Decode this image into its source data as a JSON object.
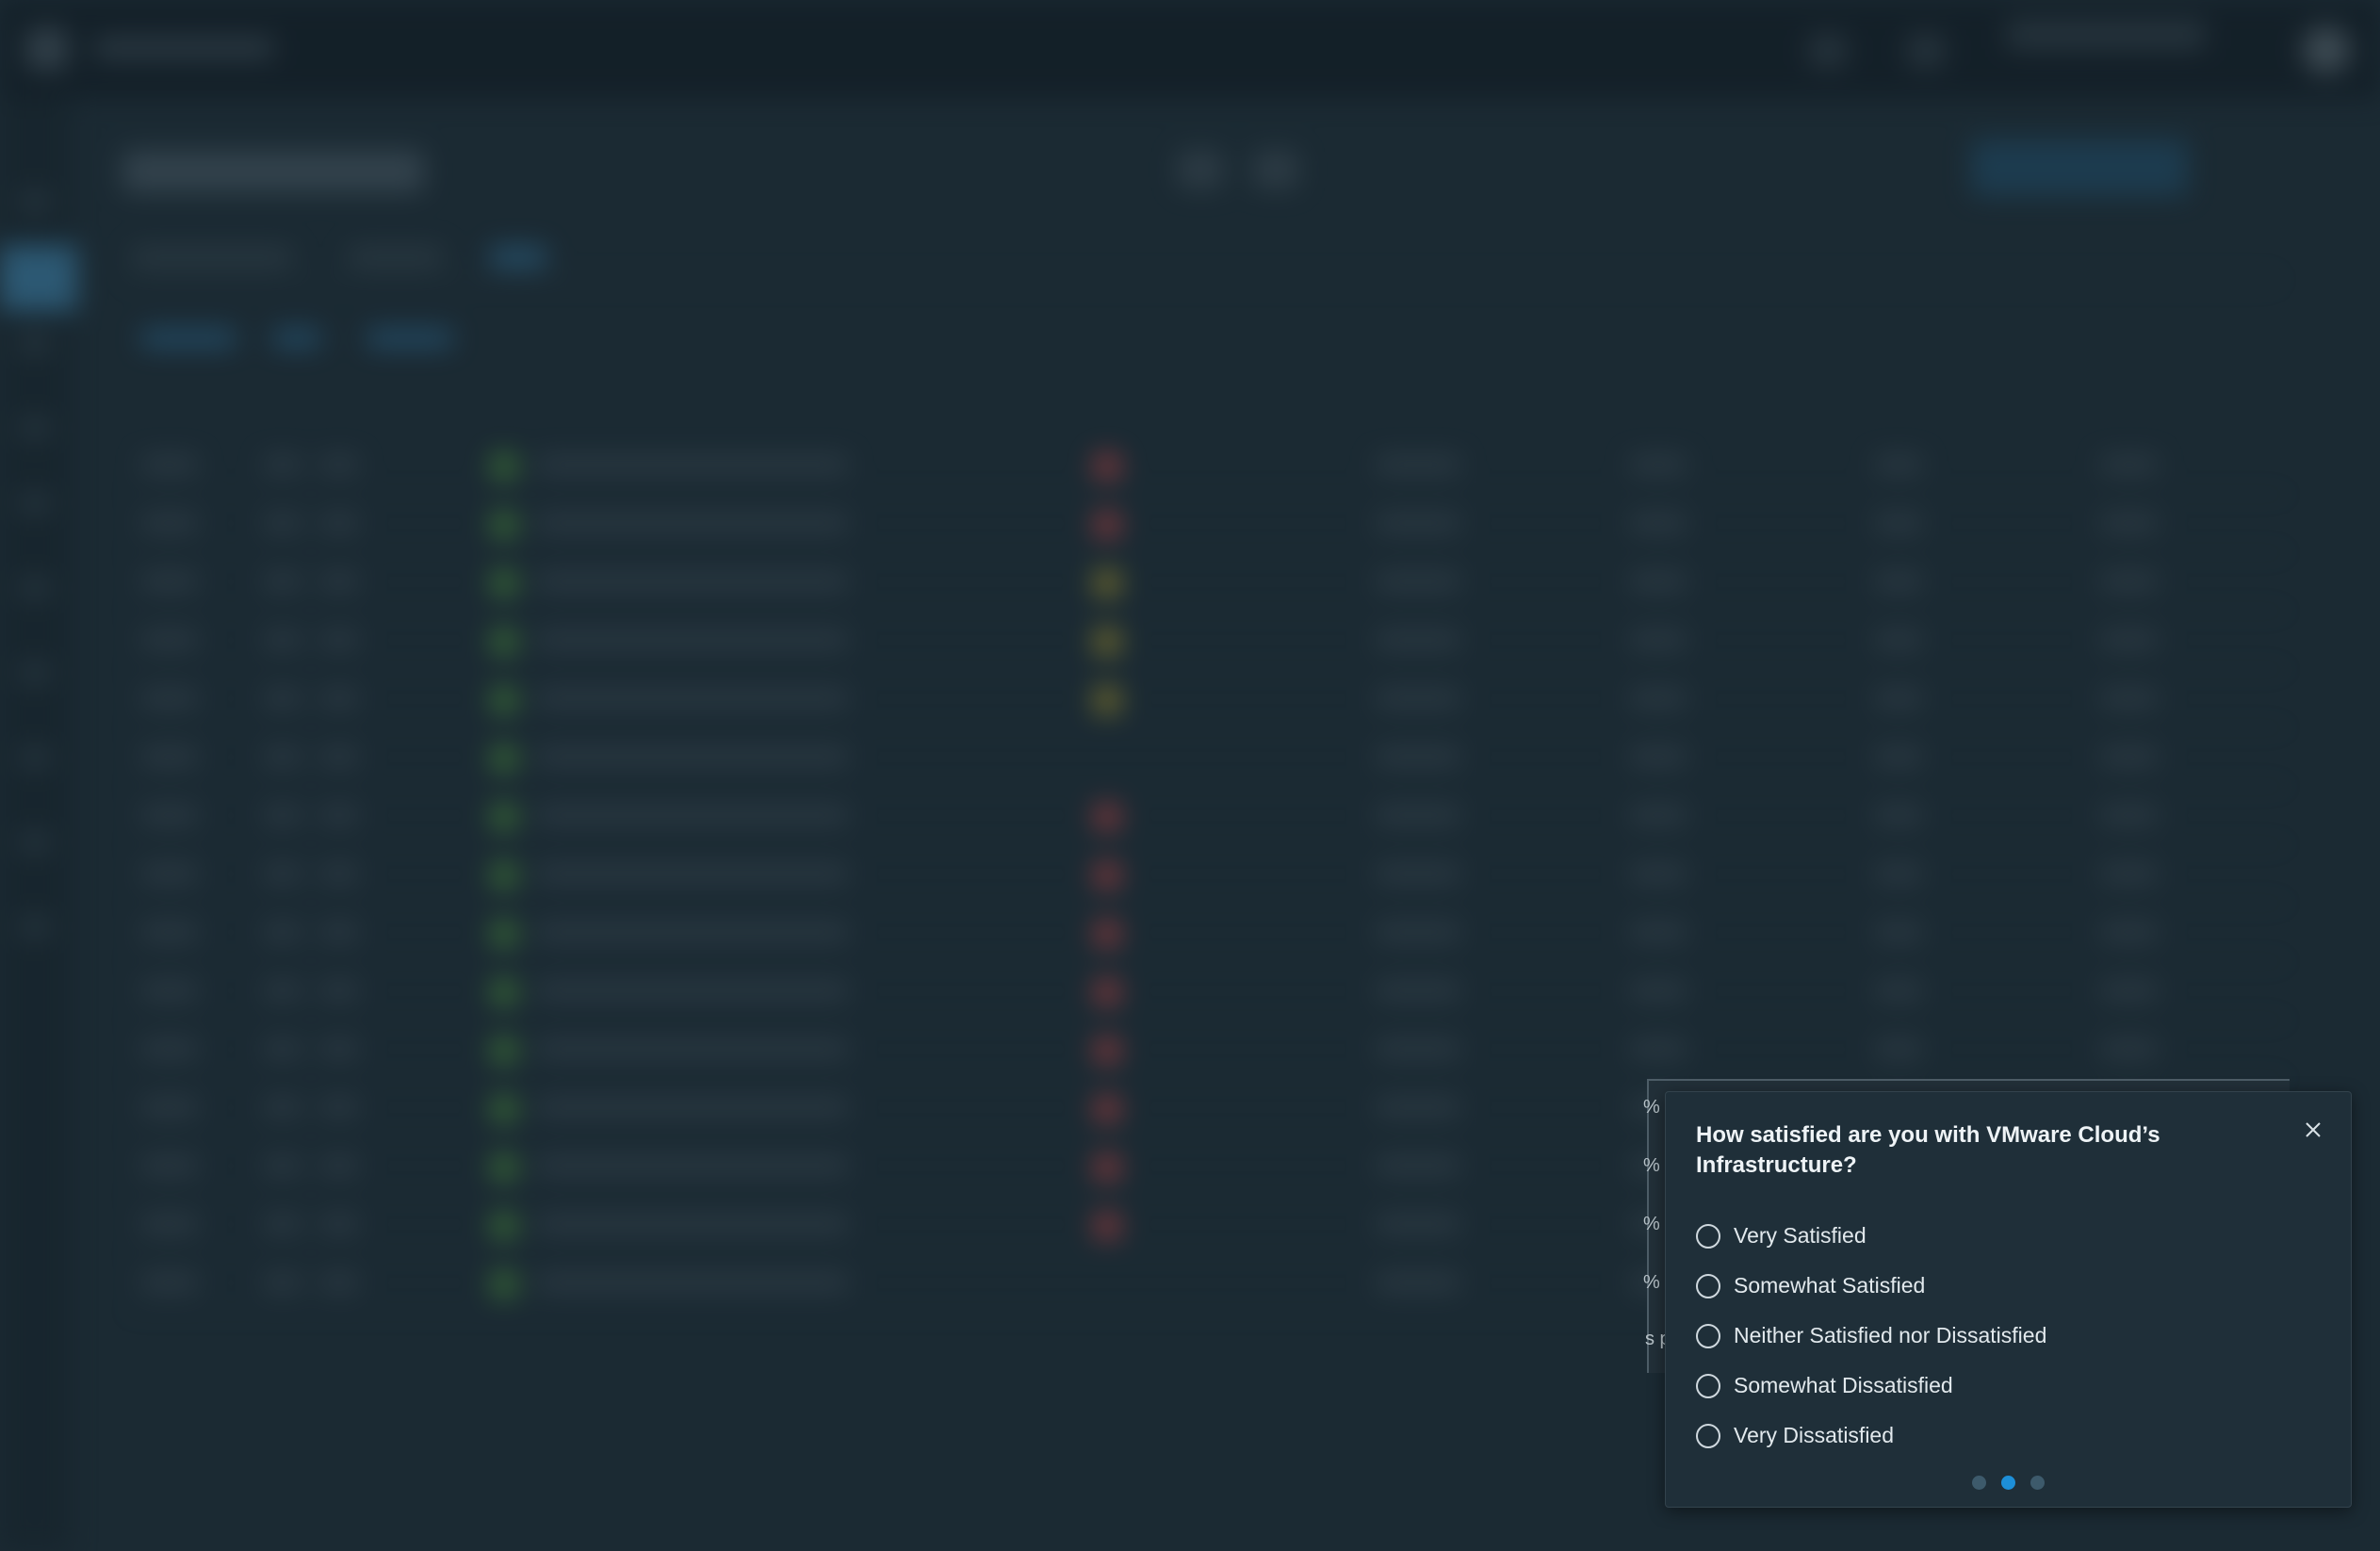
{
  "survey": {
    "question": "How satisfied are you with VMware Cloud’s Infrastructure?",
    "options": [
      "Very Satisfied",
      "Somewhat Satisfied",
      "Neither Satisfied nor Dissatisfied",
      "Somewhat Dissatisfied",
      "Very Dissatisfied"
    ],
    "pages_total": 3,
    "current_page": 2,
    "close_icon": "close-icon"
  },
  "covered_fragments": {
    "percent_glyph": "%",
    "per_page_fragment": "s p"
  },
  "colors": {
    "popup_bg": "#1f2f39",
    "accent": "#1d8fd8",
    "pager_inactive": "#3d5a6b",
    "status_red": "#d04444",
    "status_yellow": "#b8a02a",
    "status_green": "#4f9a3a"
  }
}
